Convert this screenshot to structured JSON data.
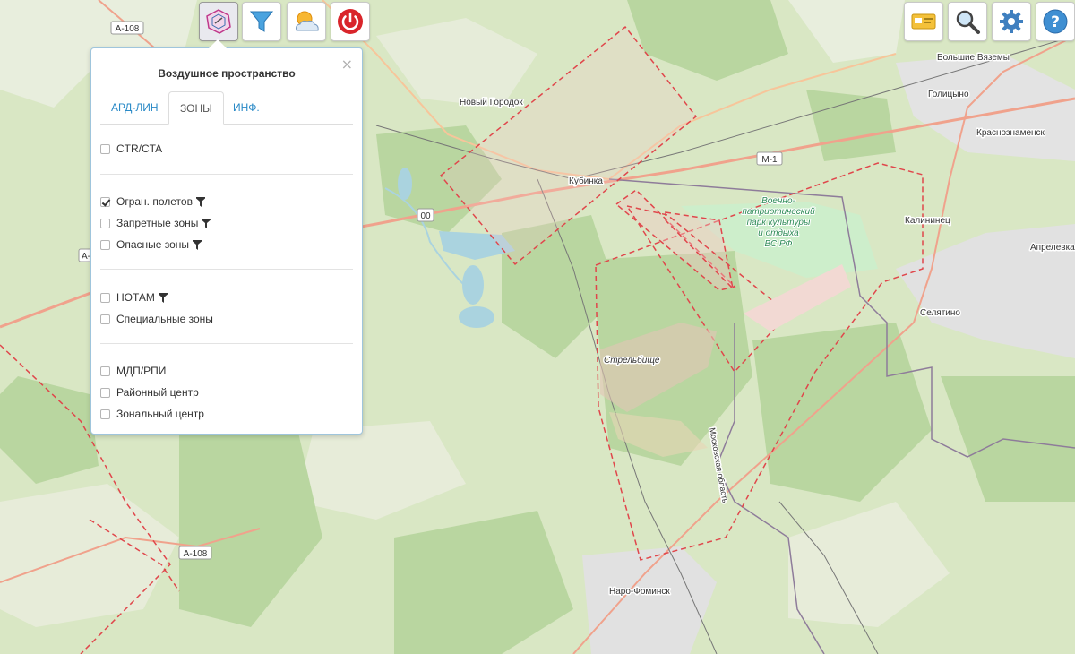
{
  "toolbar": {
    "left": [
      {
        "name": "airspace-button",
        "icon": "airspace-icon",
        "active": true
      },
      {
        "name": "filter-button",
        "icon": "filter-funnel-icon",
        "active": false
      },
      {
        "name": "weather-button",
        "icon": "weather-cloud-sun-icon",
        "active": false
      },
      {
        "name": "power-button",
        "icon": "power-icon",
        "active": false
      }
    ],
    "right": [
      {
        "name": "card-button",
        "icon": "id-card-icon"
      },
      {
        "name": "search-button",
        "icon": "search-icon"
      },
      {
        "name": "settings-button",
        "icon": "gear-icon"
      },
      {
        "name": "help-button",
        "icon": "help-icon"
      }
    ]
  },
  "panel": {
    "title": "Воздушное пространство",
    "close": "×",
    "tabs": [
      {
        "label": "АРД-ЛИН",
        "active": false
      },
      {
        "label": "ЗОНЫ",
        "active": true
      },
      {
        "label": "ИНФ.",
        "active": false
      }
    ],
    "groups": [
      [
        {
          "label": "CTR/CTA",
          "checked": false,
          "filter": false
        }
      ],
      [
        {
          "label": "Огран. полетов",
          "checked": true,
          "filter": true
        },
        {
          "label": "Запретные зоны",
          "checked": false,
          "filter": true
        },
        {
          "label": "Опасные зоны",
          "checked": false,
          "filter": true
        }
      ],
      [
        {
          "label": "НОТАМ",
          "checked": false,
          "filter": true
        },
        {
          "label": "Специальные зоны",
          "checked": false,
          "filter": false
        }
      ],
      [
        {
          "label": "МДП/РПИ",
          "checked": false,
          "filter": false
        },
        {
          "label": "Районный центр",
          "checked": false,
          "filter": false
        },
        {
          "label": "Зональный центр",
          "checked": false,
          "filter": false
        }
      ]
    ]
  },
  "map": {
    "places": {
      "novy_gorodok": "Новый Городок",
      "kubinka": "Кубинка",
      "bolshie_vyazemy": "Большие Вяземы",
      "golitsyno": "Голицыно",
      "krasnoznamensk": "Краснознаменск",
      "kalininets": "Калининец",
      "aprelevka": "Апрелевка",
      "selyatino": "Селятино",
      "naro_fominsk": "Наро-Фоминск",
      "strelbishche": "Стрельбище",
      "moskovskaya_oblast": "Московская область"
    },
    "park_label": [
      "Военно-",
      "патриотический",
      "парк культуры",
      "и отдыха",
      "ВС РФ"
    ],
    "roads": {
      "a108_top": "А-108",
      "a108_bottom": "А-108",
      "m1": "М-1",
      "a_left": "А-",
      "road_00": "00"
    },
    "colors": {
      "zone_border": "#e0464b",
      "zone_fill": "#f3c9c6",
      "road_major": "#f0a28c",
      "forest": "#b9d6a0",
      "background": "#d9e7c4",
      "water": "#aad3df",
      "admin_border": "#8e7c9a"
    }
  }
}
